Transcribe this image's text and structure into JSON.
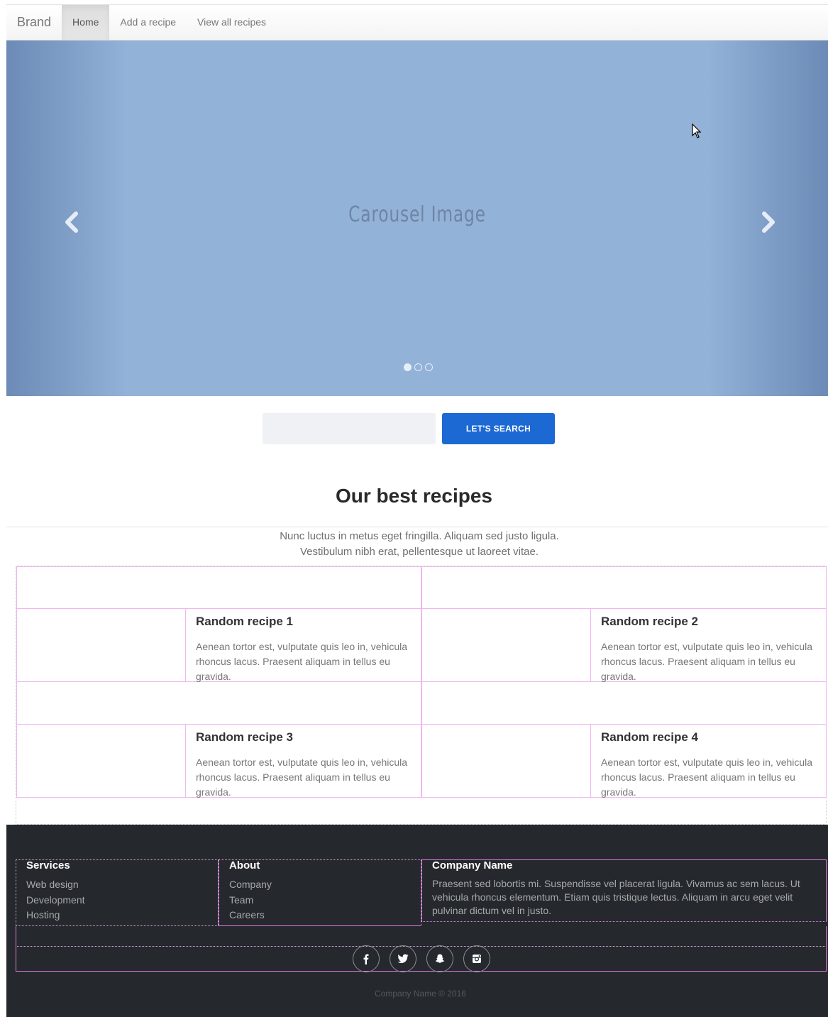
{
  "navbar": {
    "brand": "Brand",
    "items": [
      {
        "label": "Home",
        "active": true
      },
      {
        "label": "Add a recipe",
        "active": false
      },
      {
        "label": "View all recipes",
        "active": false
      }
    ]
  },
  "carousel": {
    "caption": "Carousel Image",
    "prev_icon": "chevron-left-icon",
    "next_icon": "chevron-right-icon",
    "slide_count": 3,
    "active_slide": 1,
    "background_color": "#93b2d8"
  },
  "search": {
    "placeholder": "",
    "value": "",
    "button_label": "LET'S SEARCH",
    "button_color": "#1c69d4"
  },
  "recipes_section": {
    "title": "Our best recipes",
    "intro_line1": "Nunc luctus in metus eget fringilla. Aliquam sed justo ligula.",
    "intro_line2": "Vestibulum nibh erat, pellentesque ut laoreet vitae.",
    "recipes": [
      {
        "title": "Random recipe 1",
        "text": "Aenean tortor est, vulputate quis leo in, vehicula rhoncus lacus. Praesent aliquam in tellus eu gravida."
      },
      {
        "title": "Random recipe 2",
        "text": "Aenean tortor est, vulputate quis leo in, vehicula rhoncus lacus. Praesent aliquam in tellus eu gravida."
      },
      {
        "title": "Random recipe 3",
        "text": "Aenean tortor est, vulputate quis leo in, vehicula rhoncus lacus. Praesent aliquam in tellus eu gravida."
      },
      {
        "title": "Random recipe 4",
        "text": "Aenean tortor est, vulputate quis leo in, vehicula rhoncus lacus. Praesent aliquam in tellus eu gravida."
      }
    ]
  },
  "footer": {
    "background_color": "#25282c",
    "services": {
      "title": "Services",
      "links": [
        "Web design",
        "Development",
        "Hosting"
      ]
    },
    "about": {
      "title": "About",
      "links": [
        "Company",
        "Team",
        "Careers"
      ]
    },
    "company": {
      "title": "Company Name",
      "text": "Praesent sed lobortis mi. Suspendisse vel placerat ligula. Vivamus ac sem lacus. Ut vehicula rhoncus elementum. Etiam quis tristique lectus. Aliquam in arcu eget velit pulvinar dictum vel in justo."
    },
    "social": [
      {
        "icon": "facebook-icon",
        "glyph": "f"
      },
      {
        "icon": "twitter-icon",
        "glyph": "t"
      },
      {
        "icon": "snapchat-icon",
        "glyph": "s"
      },
      {
        "icon": "instagram-icon",
        "glyph": "i"
      }
    ],
    "copyright": "Company Name © 2016"
  }
}
